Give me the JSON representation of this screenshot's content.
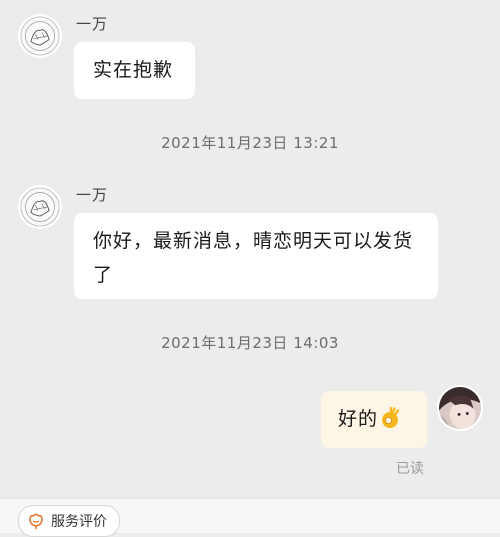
{
  "messages": [
    {
      "sender": "一万",
      "text": "实在抱歉"
    },
    {
      "sender": "一万",
      "text": "你好，最新消息，晴恋明天可以发货了"
    },
    {
      "text": "好的",
      "emoji": "ok-hand-emoji"
    }
  ],
  "timestamps": [
    "2021年11月23日 13:21",
    "2021年11月23日 14:03"
  ],
  "read_status": "已读",
  "bottom_bar": {
    "review_label": "服务评价",
    "review_icon": "flower-icon"
  },
  "colors": {
    "background": "#ececec",
    "incoming_bubble": "#ffffff",
    "outgoing_bubble": "#fdf6e6",
    "accent": "#e8742c"
  }
}
